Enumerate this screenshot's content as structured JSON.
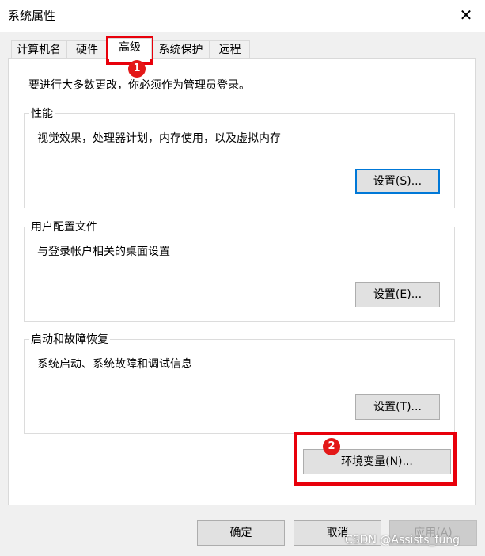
{
  "window": {
    "title": "系统属性",
    "close_icon": "✕"
  },
  "tabs": [
    {
      "label": "计算机名"
    },
    {
      "label": "硬件"
    },
    {
      "label": "高级",
      "active": true
    },
    {
      "label": "系统保护"
    },
    {
      "label": "远程"
    }
  ],
  "notice": "要进行大多数更改，你必须作为管理员登录。",
  "groups": {
    "performance": {
      "title": "性能",
      "description": "视觉效果，处理器计划，内存使用，以及虚拟内存",
      "button": "设置(S)..."
    },
    "user_profiles": {
      "title": "用户配置文件",
      "description": "与登录帐户相关的桌面设置",
      "button": "设置(E)..."
    },
    "startup_recovery": {
      "title": "启动和故障恢复",
      "description": "系统启动、系统故障和调试信息",
      "button": "设置(T)..."
    }
  },
  "env_button": "环境变量(N)...",
  "footer": {
    "ok": "确定",
    "cancel": "取消",
    "apply": "应用(A)"
  },
  "annotations": {
    "badge1": "1",
    "badge2": "2",
    "highlight_color": "#e8000b"
  },
  "watermark": "CSDN @Assists_fung"
}
